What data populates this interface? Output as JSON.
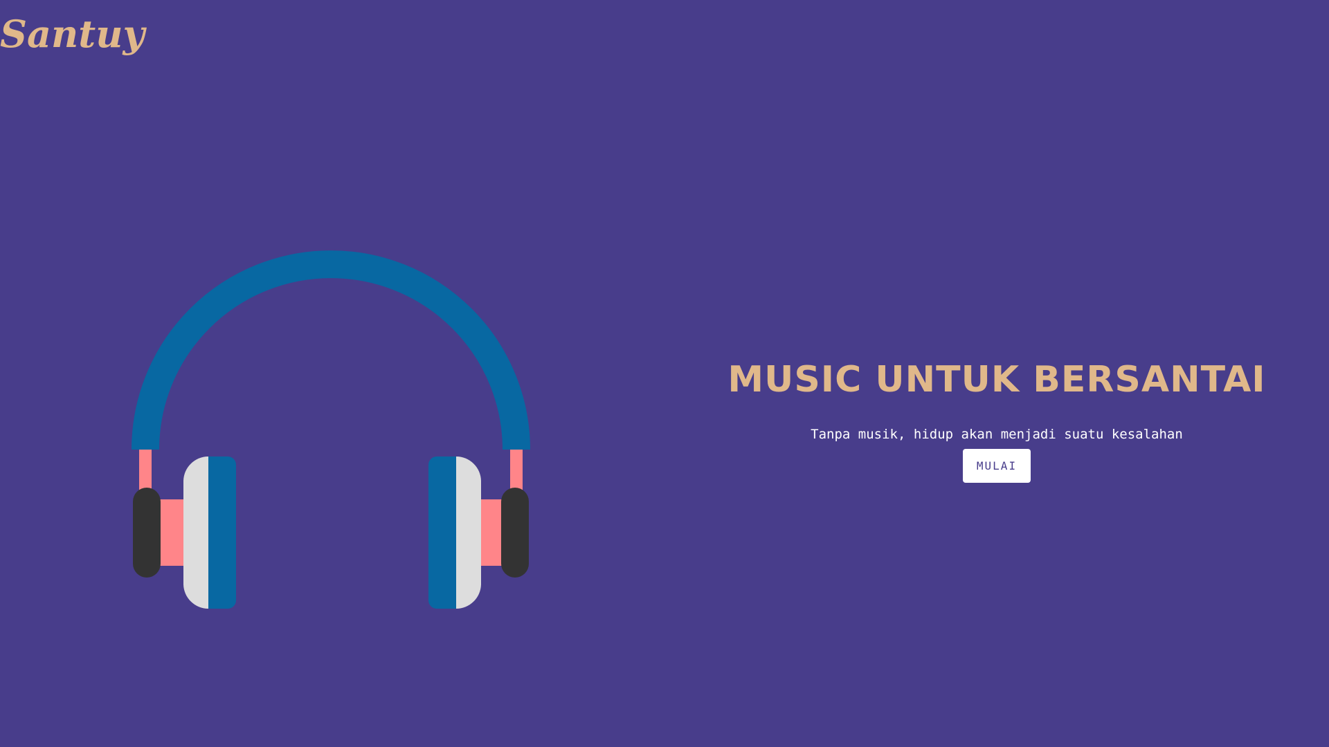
{
  "brand": {
    "logo_text": "Santuy"
  },
  "hero": {
    "title": "MUSIC UNTUK BERSANTAI",
    "tagline": "Tanpa musik, hidup akan menjadi suatu kesalahan",
    "button_label": "MULAI"
  },
  "illustration": {
    "icon": "headphones-icon"
  },
  "colors": {
    "background": "#483d8b",
    "accent": "#e0b88a",
    "headband": "#0868a2",
    "cushion": "#dddddd",
    "connector": "#ff8589",
    "cup_outer": "#333333",
    "button_bg": "#ffffff"
  }
}
